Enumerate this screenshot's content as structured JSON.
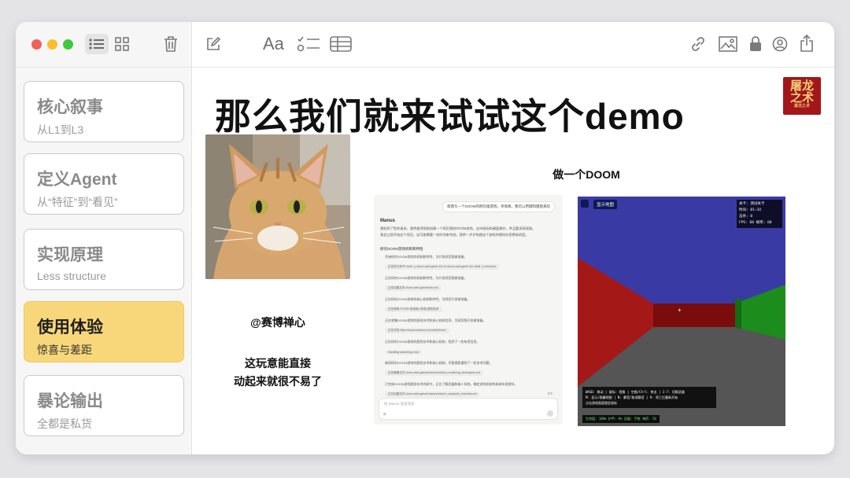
{
  "window": {
    "traffic_lights": {
      "close": "#f25f58",
      "minimize": "#fbbd2e",
      "zoom": "#3dc93f"
    }
  },
  "toolbar": {
    "format_label": "Aa",
    "icons": [
      "list-view-icon",
      "grid-view-icon",
      "trash-icon",
      "compose-icon",
      "format-icon",
      "checklist-icon",
      "table-icon",
      "link-icon",
      "media-icon",
      "lock-icon",
      "collaborate-icon",
      "share-icon"
    ]
  },
  "sidebar": {
    "items": [
      {
        "title": "核心叙事",
        "subtitle": "从L1到L3",
        "active": false
      },
      {
        "title": "定义Agent",
        "subtitle": "从“特征”到“看见”",
        "active": false
      },
      {
        "title": "实现原理",
        "subtitle": "Less structure",
        "active": false
      },
      {
        "title": "使用体验",
        "subtitle": "惊喜与差距",
        "active": true
      },
      {
        "title": "暴论输出",
        "subtitle": "全都是私货",
        "active": false
      }
    ],
    "active_color": "#f8d77a"
  },
  "note": {
    "title": "那么我们就来试试这个demo",
    "seal_text": "屠龙之术",
    "cat_caption": "@赛博禅心",
    "comment_line1": "这玩意能直接",
    "comment_line2": "动起来就很不易了",
    "doom_label": "做一个DOOM"
  },
  "chat": {
    "user_message": "帮我写一个DOOM的网页版游戏，单保真，我可以用键和键盘来玩",
    "assistant_name": "Manus",
    "intro_1": "我收到了您的请求。我将使用帮助创建一个网页版的DOOM游戏，支持鼠标和键盘操作，并且要求高保真。",
    "intro_2": "我会立即开始这个项目，这可能需要一些时间来完成。我将一步步构建这个游戏并随时向您更新进度。",
    "plan_header": "研究DOOM游戏机制和特性",
    "steps": [
      {
        "text": "开始研究DOOM游戏的机制和特性，为开发网页版做准备。",
        "chip": "正在执行命令 mkdir -p doom-web-game && cd doom-web-game && mkdir -p research"
      },
      {
        "text": "正在研究DOOM游戏的机制和特性，为开发网页版做准备。",
        "chip": "正在创建文件 doom-web-game/todo.md"
      },
      {
        "text": "正在研究DOOM游戏的核心机制和特性，为网页开发做准备。",
        "chip": "正在搜索 DOOM 游戏核心机制 图形技术"
      },
      {
        "text": "正在收集DOOM游戏的图形技术和核心机制信息，为网页版开发做准备。",
        "chip": "正在浏览 https://doom.fandom.com/wiki/Doom"
      },
      {
        "text": "正在研究DOOM游戏的图形技术和核心机制，找到了一些有用信息。",
        "chip": "Handling searching error"
      },
      {
        "text": "继续研究DOOM游戏的图形技术和核心机制，尽管搜索遇到了一些技术问题。",
        "chip": "正在编辑文件 doom-web-game/research/doom_rendering_techniques.md"
      },
      {
        "text": "已完成DOOM游戏图形技术的研究，正在了解武器和敌人系统，确定游戏机制的具体实现细节。",
        "chip": "正在创建文件 doom-web-game/research/doom_weapons_enemies.md"
      },
      {
        "text": "完成游戏核心机制和关卡研究，加入AI和武器系统，便于快速实现游戏渲染效果。",
        "chip": "Manus将在任务完成后通知您"
      }
    ],
    "input_placeholder": "给 Manus 发送消息",
    "page_count": "8/8"
  },
  "game": {
    "top_button": "显示地图",
    "hud": {
      "level": "关卡: 测试关卡",
      "time": "时间: 01:34",
      "kills": "击杀: 0",
      "fps": "FPS: 60  帧率: 60"
    },
    "help_1": "WASD: 移动 | 鼠标: 视角 | 空格/Ctrl: 射击 | 1-7: 切换武器",
    "help_2": "M: 显示/隐藏地图 | N: 静音/取消静音 | R: 死亡后重新开始",
    "help_3": "点击游戏画面锁定鼠标",
    "status": "生命值: 100%  护甲: 0%  武器: 手枪  弹药: 50",
    "crosshair": "+",
    "colors": {
      "ceiling": "#3a3aa5",
      "wall_left": "#a51818",
      "wall_right": "#1c8c1c",
      "wall_center": "#7a0c0c",
      "floor": "#555555"
    }
  }
}
